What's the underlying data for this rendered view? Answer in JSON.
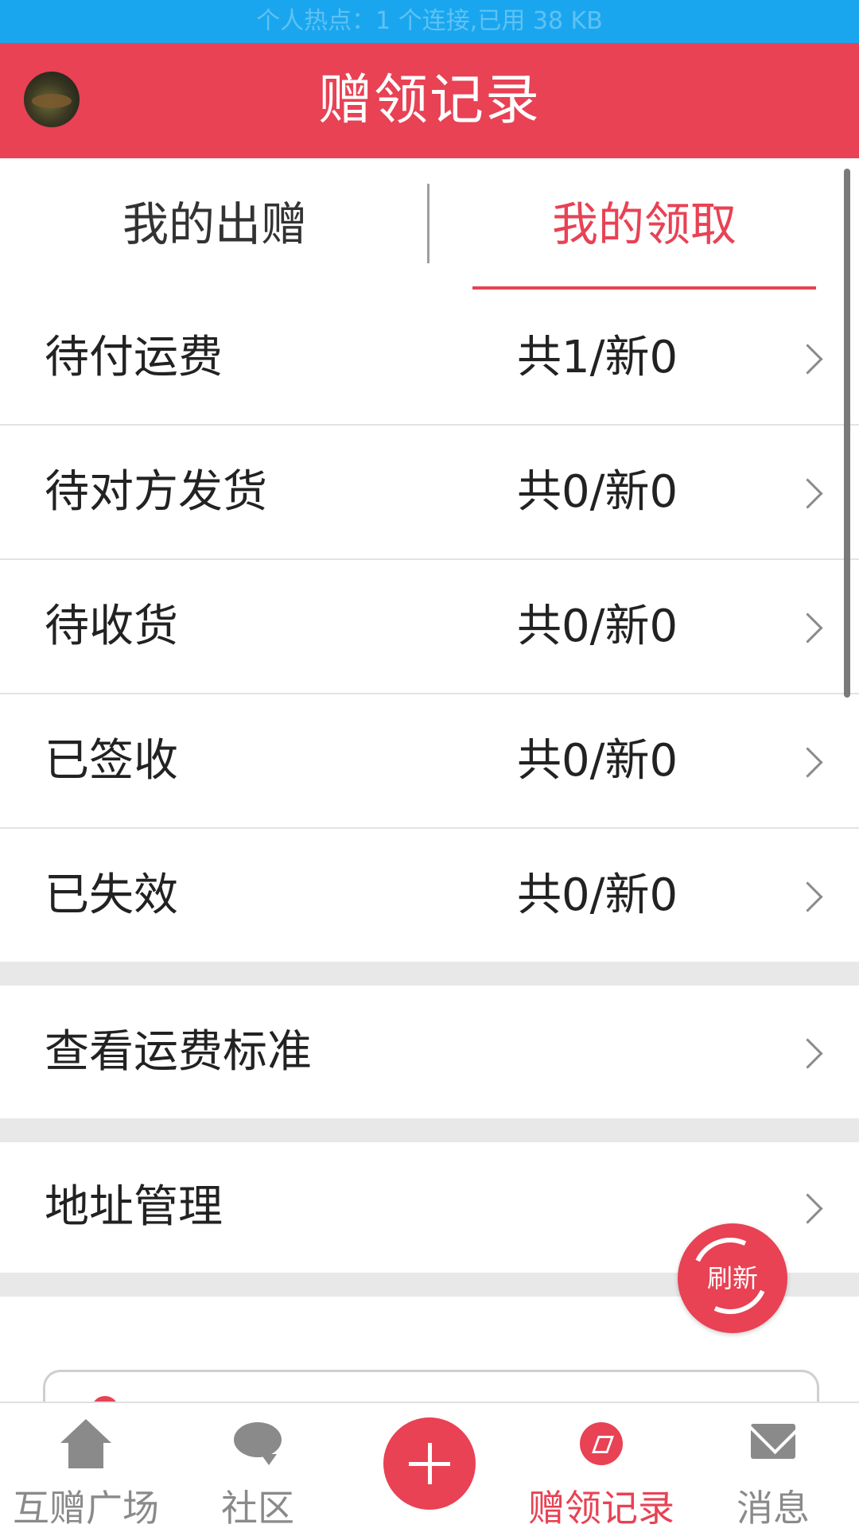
{
  "status_bar": {
    "text": "个人热点：1 个连接,已用 38 KB"
  },
  "app_bar": {
    "title": "赠领记录"
  },
  "tabs": [
    {
      "label": "我的出赠",
      "active": false
    },
    {
      "label": "我的领取",
      "active": true
    }
  ],
  "records": [
    {
      "label": "待付运费",
      "count": "共1/新0"
    },
    {
      "label": "待对方发货",
      "count": "共0/新0"
    },
    {
      "label": "待收货",
      "count": "共0/新0"
    },
    {
      "label": "已签收",
      "count": "共0/新0"
    },
    {
      "label": "已失效",
      "count": "共0/新0"
    }
  ],
  "links": {
    "shipping_standard": "查看运费标准",
    "address_management": "地址管理"
  },
  "refresh_button": {
    "label": "刷新"
  },
  "bottom_nav": [
    {
      "label": "互赠广场",
      "icon": "home-icon",
      "active": false
    },
    {
      "label": "社区",
      "icon": "chat-bubble-icon",
      "active": false
    },
    {
      "label": "",
      "icon": "plus-icon",
      "active": false
    },
    {
      "label": "赠领记录",
      "icon": "compass-icon",
      "active": true
    },
    {
      "label": "消息",
      "icon": "mail-icon",
      "active": false
    }
  ],
  "colors": {
    "brand": "#e84254",
    "status_bar": "#1aa6ef"
  }
}
